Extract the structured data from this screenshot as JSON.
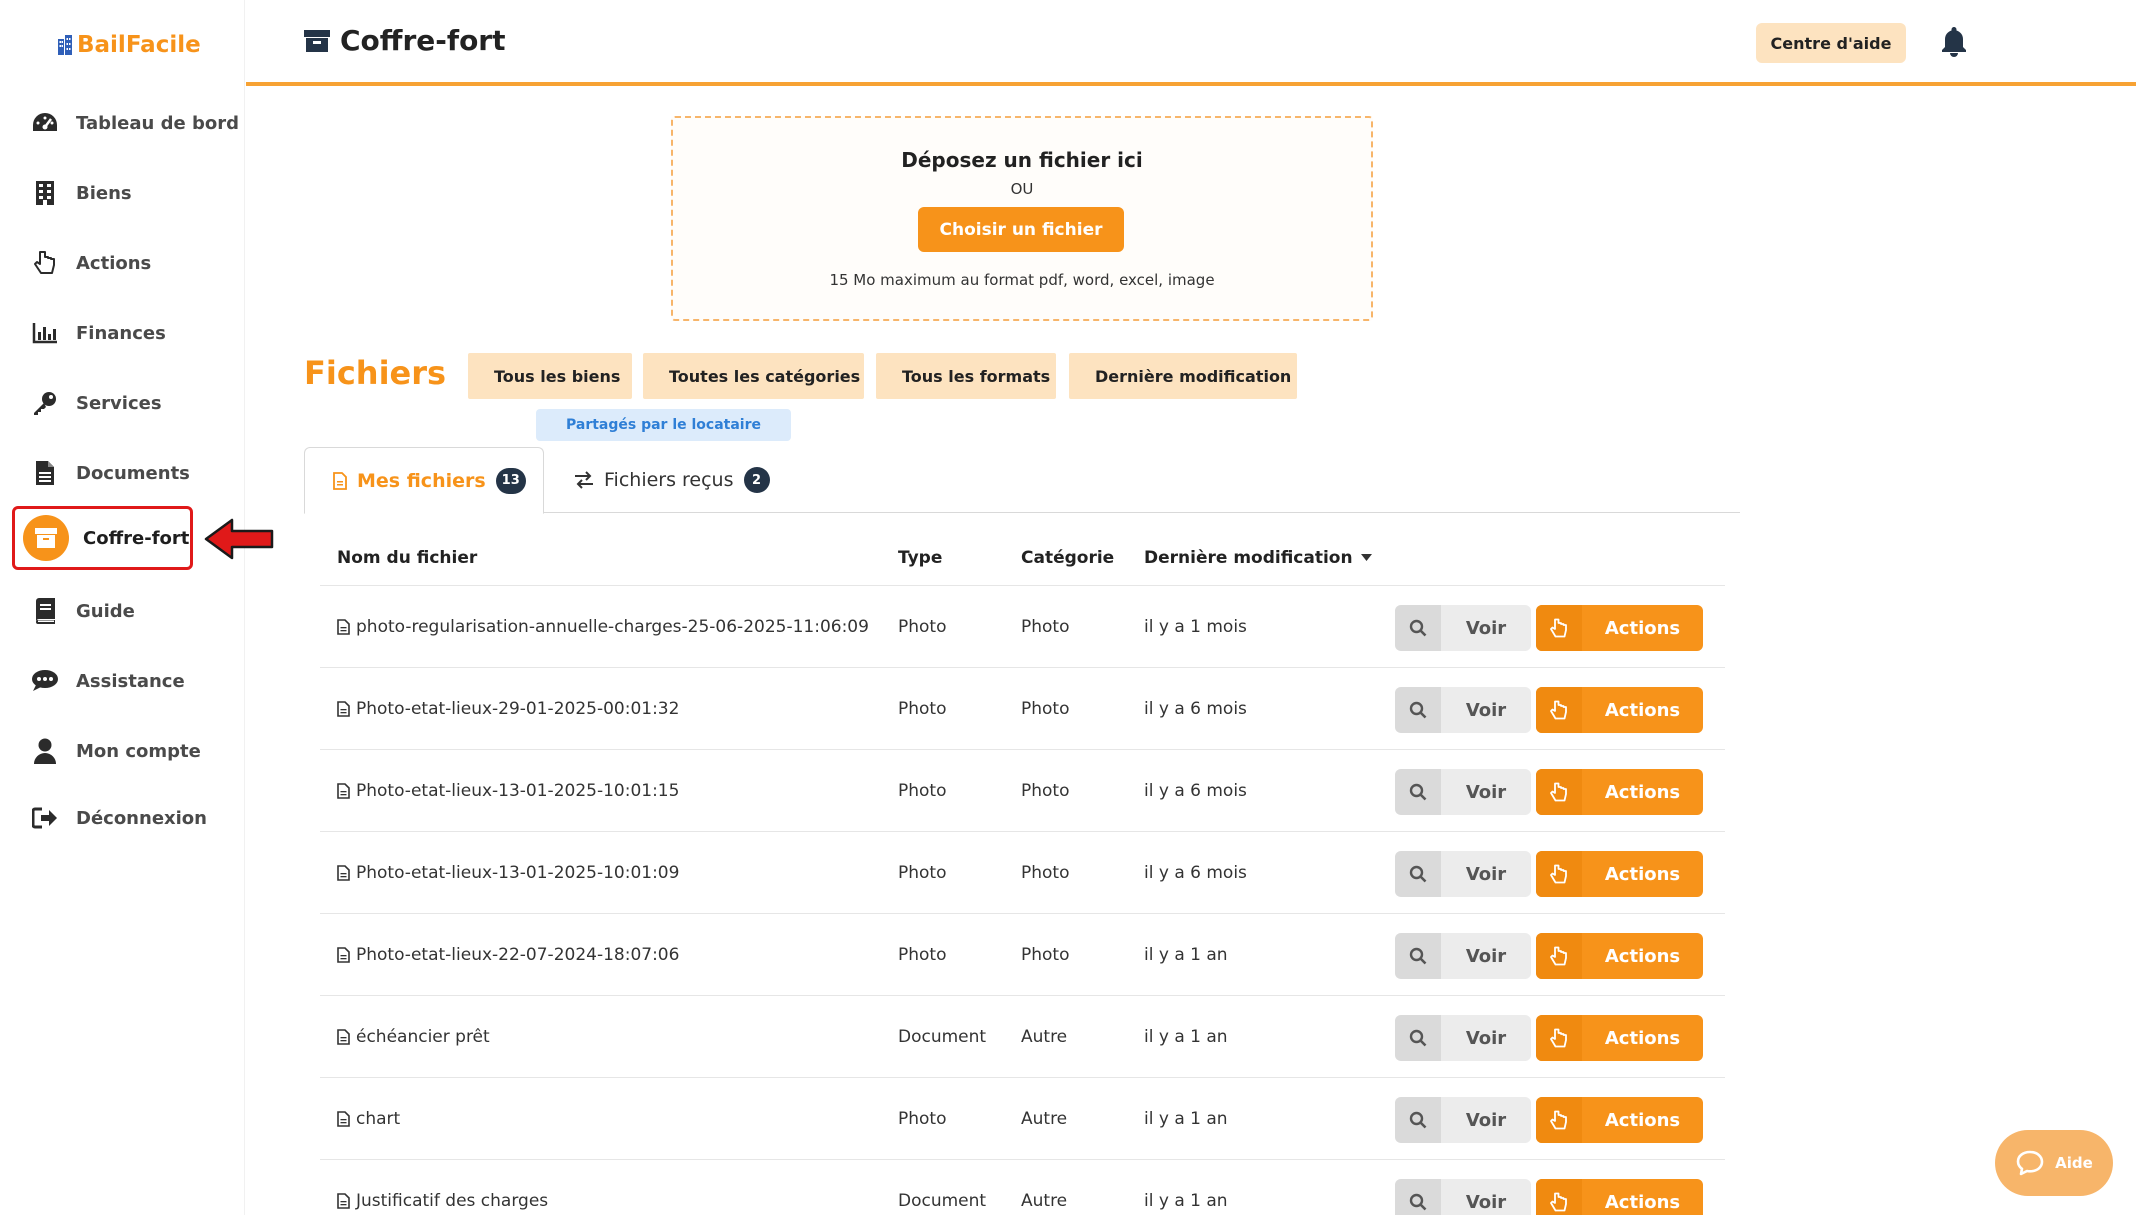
{
  "app": {
    "logo_text": "BailFacile"
  },
  "sidebar": {
    "items": [
      {
        "label": "Tableau de bord",
        "icon": "dashboard-icon"
      },
      {
        "label": "Biens",
        "icon": "building-icon"
      },
      {
        "label": "Actions",
        "icon": "pointer-hand-icon"
      },
      {
        "label": "Finances",
        "icon": "bar-chart-icon"
      },
      {
        "label": "Services",
        "icon": "key-icon"
      },
      {
        "label": "Documents",
        "icon": "document-icon"
      },
      {
        "label": "Coffre-fort",
        "icon": "archive-icon",
        "active": true
      },
      {
        "label": "Guide",
        "icon": "book-icon"
      },
      {
        "label": "Assistance",
        "icon": "chat-icon"
      },
      {
        "label": "Mon compte",
        "icon": "user-icon"
      },
      {
        "label": "Déconnexion",
        "icon": "logout-icon"
      }
    ]
  },
  "header": {
    "title": "Coffre-fort",
    "help_label": "Centre d'aide"
  },
  "upload": {
    "title": "Déposez un fichier ici",
    "or": "OU",
    "button": "Choisir un fichier",
    "hint": "15 Mo maximum au format pdf, word, excel, image"
  },
  "files": {
    "title": "Fichiers",
    "filters": [
      "Tous les biens",
      "Toutes les catégories",
      "Tous les formats",
      "Dernière modification"
    ],
    "shared_chip": "Partagés par le locataire",
    "tabs": [
      {
        "label": "Mes fichiers",
        "count": "13"
      },
      {
        "label": "Fichiers reçus",
        "count": "2"
      }
    ],
    "columns": {
      "name": "Nom du fichier",
      "type": "Type",
      "category": "Catégorie",
      "modified": "Dernière modification"
    },
    "view_label": "Voir",
    "actions_label": "Actions",
    "rows": [
      {
        "name": "photo-regularisation-annuelle-charges-25-06-2025-11:06:09",
        "type": "Photo",
        "category": "Photo",
        "modified": "il y a 1 mois"
      },
      {
        "name": "Photo-etat-lieux-29-01-2025-00:01:32",
        "type": "Photo",
        "category": "Photo",
        "modified": "il y a 6 mois"
      },
      {
        "name": "Photo-etat-lieux-13-01-2025-10:01:15",
        "type": "Photo",
        "category": "Photo",
        "modified": "il y a 6 mois"
      },
      {
        "name": "Photo-etat-lieux-13-01-2025-10:01:09",
        "type": "Photo",
        "category": "Photo",
        "modified": "il y a 6 mois"
      },
      {
        "name": "Photo-etat-lieux-22-07-2024-18:07:06",
        "type": "Photo",
        "category": "Photo",
        "modified": "il y a 1 an"
      },
      {
        "name": "échéancier prêt",
        "type": "Document",
        "category": "Autre",
        "modified": "il y a 1 an"
      },
      {
        "name": "chart",
        "type": "Photo",
        "category": "Autre",
        "modified": "il y a 1 an"
      },
      {
        "name": "Justificatif des charges",
        "type": "Document",
        "category": "Autre",
        "modified": "il y a 1 an"
      }
    ]
  },
  "floating_help": {
    "label": "Aide"
  },
  "colors": {
    "accent": "#f7931a",
    "accent_light": "#fde3c0",
    "highlight_border": "#e01919"
  }
}
